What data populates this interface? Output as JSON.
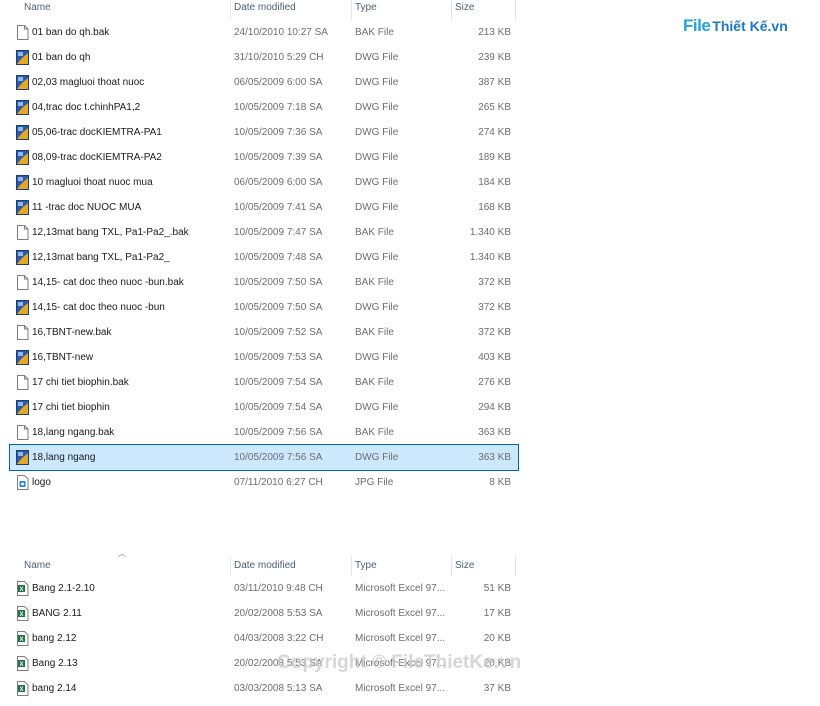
{
  "columns": {
    "name": "Name",
    "date": "Date modified",
    "type": "Type",
    "size": "Size"
  },
  "top_list": [
    {
      "icon": "blank-file-icon",
      "name": "01 ban do qh.bak",
      "date": "24/10/2010 10:27 SA",
      "type": "BAK File",
      "size": "213 KB"
    },
    {
      "icon": "dwg-file-icon",
      "name": "01 ban do qh",
      "date": "31/10/2010 5:29 CH",
      "type": "DWG File",
      "size": "239 KB"
    },
    {
      "icon": "dwg-file-icon",
      "name": "02,03 magluoi thoat nuoc",
      "date": "06/05/2009 6:00 SA",
      "type": "DWG File",
      "size": "387 KB"
    },
    {
      "icon": "dwg-file-icon",
      "name": "04,trac doc t.chinhPA1,2",
      "date": "10/05/2009 7:18 SA",
      "type": "DWG File",
      "size": "265 KB"
    },
    {
      "icon": "dwg-file-icon",
      "name": "05,06-trac docKIEMTRA-PA1",
      "date": "10/05/2009 7:36 SA",
      "type": "DWG File",
      "size": "274 KB"
    },
    {
      "icon": "dwg-file-icon",
      "name": "08,09-trac docKIEMTRA-PA2",
      "date": "10/05/2009 7:39 SA",
      "type": "DWG File",
      "size": "189 KB"
    },
    {
      "icon": "dwg-file-icon",
      "name": "10 magluoi thoat nuoc mua",
      "date": "06/05/2009 6:00 SA",
      "type": "DWG File",
      "size": "184 KB"
    },
    {
      "icon": "dwg-file-icon",
      "name": "11 -trac doc NUOC MUA",
      "date": "10/05/2009 7:41 SA",
      "type": "DWG File",
      "size": "168 KB"
    },
    {
      "icon": "blank-file-icon",
      "name": "12,13mat bang TXL, Pa1-Pa2_.bak",
      "date": "10/05/2009 7:47 SA",
      "type": "BAK File",
      "size": "1.340 KB"
    },
    {
      "icon": "dwg-file-icon",
      "name": "12,13mat bang TXL, Pa1-Pa2_",
      "date": "10/05/2009 7:48 SA",
      "type": "DWG File",
      "size": "1.340 KB"
    },
    {
      "icon": "blank-file-icon",
      "name": "14,15- cat doc theo nuoc -bun.bak",
      "date": "10/05/2009 7:50 SA",
      "type": "BAK File",
      "size": "372 KB"
    },
    {
      "icon": "dwg-file-icon",
      "name": "14,15- cat doc theo nuoc -bun",
      "date": "10/05/2009 7:50 SA",
      "type": "DWG File",
      "size": "372 KB"
    },
    {
      "icon": "blank-file-icon",
      "name": "16,TBNT-new.bak",
      "date": "10/05/2009 7:52 SA",
      "type": "BAK File",
      "size": "372 KB"
    },
    {
      "icon": "dwg-file-icon",
      "name": "16,TBNT-new",
      "date": "10/05/2009 7:53 SA",
      "type": "DWG File",
      "size": "403 KB"
    },
    {
      "icon": "blank-file-icon",
      "name": "17 chi tiet biophin.bak",
      "date": "10/05/2009 7:54 SA",
      "type": "BAK File",
      "size": "276 KB"
    },
    {
      "icon": "dwg-file-icon",
      "name": "17 chi tiet biophin",
      "date": "10/05/2009 7:54 SA",
      "type": "DWG File",
      "size": "294 KB"
    },
    {
      "icon": "blank-file-icon",
      "name": "18,lang ngang.bak",
      "date": "10/05/2009 7:56 SA",
      "type": "BAK File",
      "size": "363 KB"
    },
    {
      "icon": "dwg-file-icon",
      "name": "18,lang ngang",
      "date": "10/05/2009 7:56 SA",
      "type": "DWG File",
      "size": "363 KB",
      "selected": true
    },
    {
      "icon": "jpg-file-icon",
      "name": "logo",
      "date": "07/11/2010 6:27 CH",
      "type": "JPG File",
      "size": "8 KB"
    }
  ],
  "bottom_list": [
    {
      "icon": "excel-file-icon",
      "name": "Bang 2.1-2.10",
      "date": "03/11/2010 9:48 CH",
      "type": "Microsoft Excel 97...",
      "size": "51 KB"
    },
    {
      "icon": "excel-file-icon",
      "name": "BANG 2.11",
      "date": "20/02/2008 5:53 SA",
      "type": "Microsoft Excel 97...",
      "size": "17 KB"
    },
    {
      "icon": "excel-file-icon",
      "name": "bang 2.12",
      "date": "04/03/2008 3:22 CH",
      "type": "Microsoft Excel 97...",
      "size": "20 KB"
    },
    {
      "icon": "excel-file-icon",
      "name": "Bang 2.13",
      "date": "20/02/2008 5:53 SA",
      "type": "Microsoft Excel 97...",
      "size": "20 KB"
    },
    {
      "icon": "excel-file-icon",
      "name": "bang 2.14",
      "date": "03/03/2008 5:13 SA",
      "type": "Microsoft Excel 97...",
      "size": "37 KB"
    }
  ],
  "logo": {
    "part1": "File",
    "part2": "Thiết Kế.vn"
  },
  "watermark": "Copyright © FileThietKe.vn"
}
